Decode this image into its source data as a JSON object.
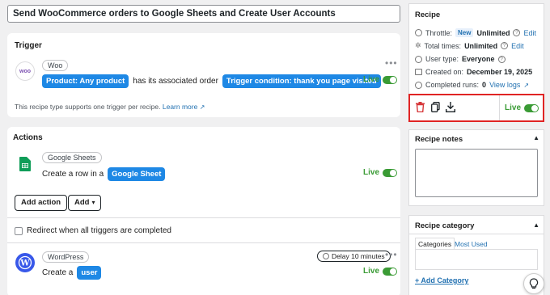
{
  "recipe_title": "Send WooCommerce orders to Google Sheets and Create User Accounts",
  "trigger": {
    "heading": "Trigger",
    "integration": "Woo",
    "avatar_text": "woo",
    "token_1": "Product: Any product",
    "text_1": "has its associated order",
    "token_2": "Trigger condition: thank you page visited",
    "live_label": "Live",
    "note": "This recipe type supports one trigger per recipe.",
    "learn_more": "Learn more"
  },
  "actions": {
    "heading": "Actions",
    "sheets": {
      "integration": "Google Sheets",
      "text": "Create a row in a",
      "token": "Google Sheet",
      "live_label": "Live"
    },
    "add_action_label": "Add action",
    "add_label": "Add",
    "redirect_label": "Redirect when all triggers are completed",
    "wordpress": {
      "integration": "WordPress",
      "delay_label": "Delay 10 minutes",
      "text": "Create a",
      "token": "user",
      "live_label": "Live"
    }
  },
  "recipe_panel": {
    "heading": "Recipe",
    "throttle_label": "Throttle:",
    "throttle_badge": "New",
    "throttle_value": "Unlimited",
    "edit_label": "Edit",
    "total_times_label": "Total times:",
    "total_times_value": "Unlimited",
    "user_type_label": "User type:",
    "user_type_value": "Everyone",
    "created_label": "Created on:",
    "created_value": "December 19, 2025",
    "completed_label": "Completed runs:",
    "completed_value": "0",
    "view_logs": "View logs",
    "live_label": "Live"
  },
  "notes_panel": {
    "heading": "Recipe notes"
  },
  "category_panel": {
    "heading": "Recipe category",
    "tab_categories": "Categories",
    "tab_most_used": "Most Used",
    "add_category": "+ Add Category"
  },
  "colors": {
    "accent": "#1e88e5",
    "live": "#3a9b35",
    "highlight": "#e02424"
  }
}
